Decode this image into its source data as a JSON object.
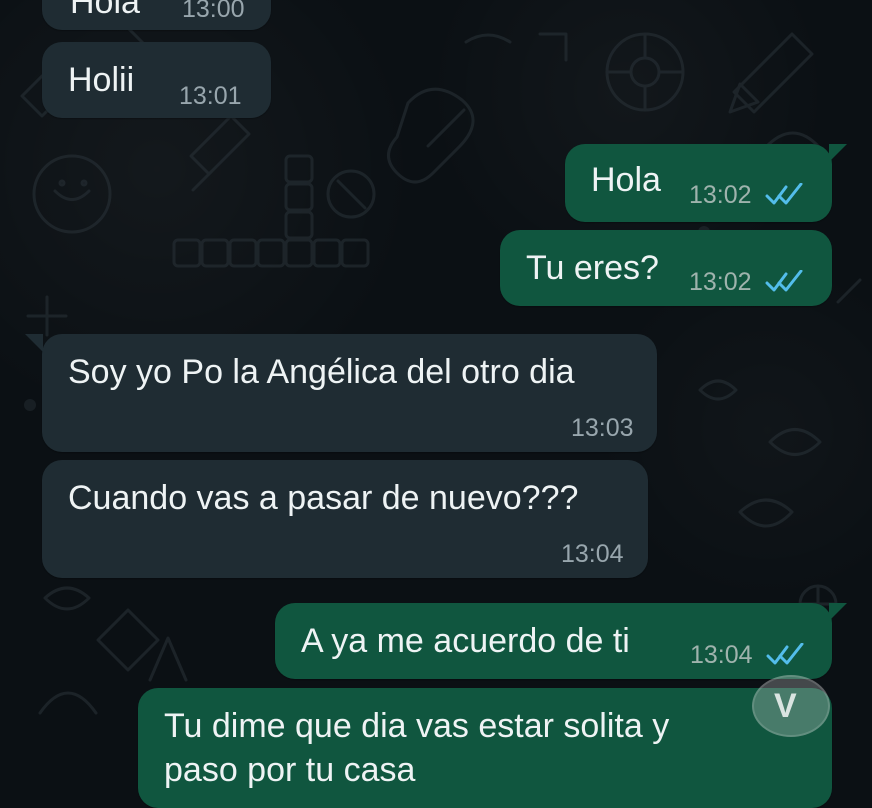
{
  "theme": {
    "background": "#0b1014",
    "incoming_bubble": "#1f2c33",
    "outgoing_bubble": "#10563f",
    "text": "#eef3f4",
    "time_text": "#98a6ad",
    "read_tick": "#53bdeb",
    "watermark_color": "#d9d9d9"
  },
  "watermark": {
    "letter": "V"
  },
  "messages": [
    {
      "direction": "incoming",
      "text": "Hola",
      "time": "13:00",
      "read_status": null
    },
    {
      "direction": "incoming",
      "text": "Holii",
      "time": "13:01",
      "read_status": null
    },
    {
      "direction": "outgoing",
      "text": "Hola",
      "time": "13:02",
      "read_status": "read-double-check"
    },
    {
      "direction": "outgoing",
      "text": "Tu eres?",
      "time": "13:02",
      "read_status": "read-double-check"
    },
    {
      "direction": "incoming",
      "text": "Soy yo Po la Angélica del otro dia",
      "time": "13:03",
      "read_status": null
    },
    {
      "direction": "incoming",
      "text": "Cuando vas a pasar de nuevo???",
      "time": "13:04",
      "read_status": null
    },
    {
      "direction": "outgoing",
      "text": "A ya me acuerdo de ti",
      "time": "13:04",
      "read_status": "read-double-check"
    },
    {
      "direction": "outgoing",
      "text_lines": [
        "Tu dime que dia vas estar solita y",
        "paso por tu casa"
      ],
      "time": null,
      "read_status": null
    }
  ]
}
